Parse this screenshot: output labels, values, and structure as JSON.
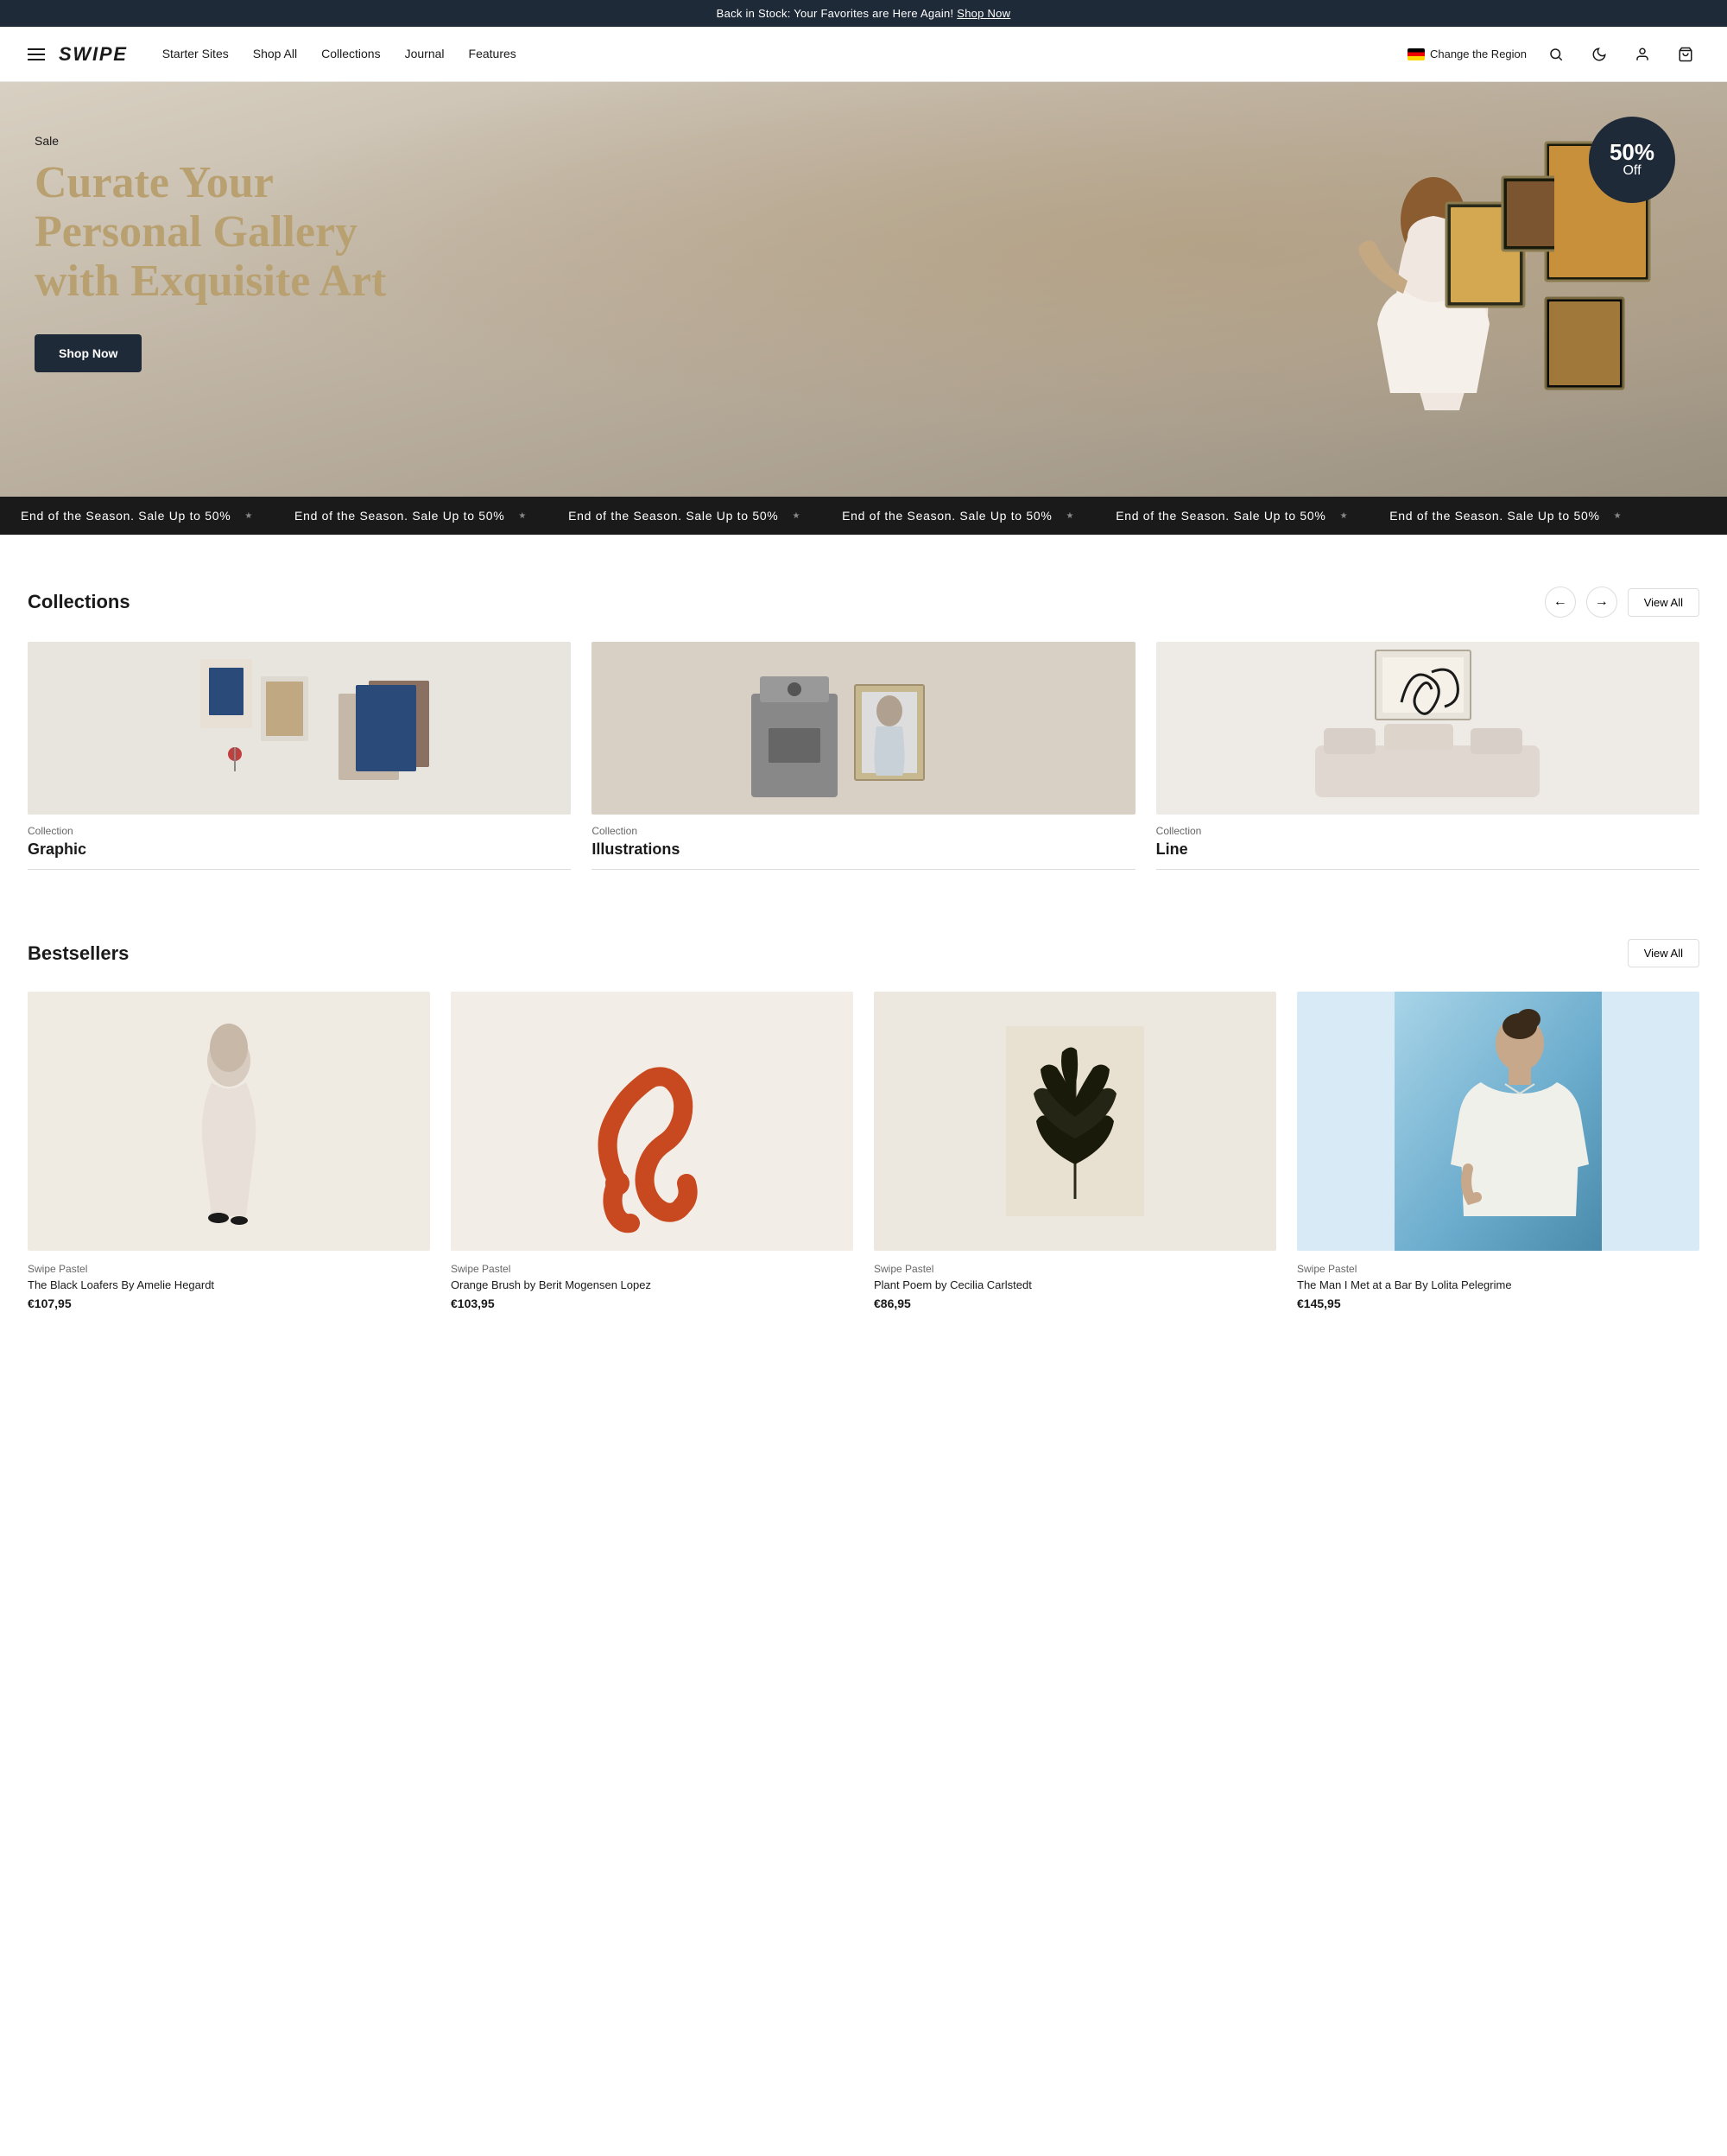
{
  "announcement": {
    "text": "Back in Stock: Your Favorites are Here Again! ",
    "link_text": "Shop Now",
    "link_href": "#"
  },
  "nav": {
    "logo": "SWiPE",
    "links": [
      {
        "label": "Starter Sites",
        "href": "#"
      },
      {
        "label": "Shop All",
        "href": "#"
      },
      {
        "label": "Collections",
        "href": "#"
      },
      {
        "label": "Journal",
        "href": "#"
      },
      {
        "label": "Features",
        "href": "#"
      }
    ],
    "region_label": "Change the Region",
    "icons": [
      "search",
      "dark-mode",
      "account",
      "cart"
    ]
  },
  "hero": {
    "sale_label": "Sale",
    "title": "Curate Your Personal Gallery with Exquisite Art",
    "cta_label": "Shop Now",
    "badge_main": "50%",
    "badge_sub": "Off"
  },
  "marquee": {
    "text": "End of the Season. Sale Up to 50%",
    "items": [
      "End of the Season. Sale Up to 50%",
      "End of the Season. Sale Up to 50%",
      "End of the Season. Sale Up to 50%",
      "End of the Season. Sale Up to 50%",
      "End of the Season. Sale Up to 50%",
      "End of the Season. Sale Up to 50%"
    ]
  },
  "collections": {
    "section_title": "Collections",
    "view_all_label": "View All",
    "items": [
      {
        "label": "Collection",
        "name": "Graphic",
        "img_type": "graphic"
      },
      {
        "label": "Collection",
        "name": "Illustrations",
        "img_type": "illustrations"
      },
      {
        "label": "Collection",
        "name": "Line",
        "img_type": "line"
      }
    ]
  },
  "bestsellers": {
    "section_title": "Bestsellers",
    "view_all_label": "View All",
    "items": [
      {
        "brand": "Swipe Pastel",
        "name": "The Black Loafers By Amelie Hegardt",
        "price": "€107,95",
        "img_type": "figure"
      },
      {
        "brand": "Swipe Pastel",
        "name": "Orange Brush by Berit Mogensen Lopez",
        "price": "€103,95",
        "img_type": "abstract"
      },
      {
        "brand": "Swipe Pastel",
        "name": "Plant Poem by Cecilia Carlstedt",
        "price": "€86,95",
        "img_type": "leaf"
      },
      {
        "brand": "Swipe Pastel",
        "name": "The Man I Met at a Bar By Lolita Pelegrime",
        "price": "€145,95",
        "img_type": "portrait"
      }
    ]
  }
}
